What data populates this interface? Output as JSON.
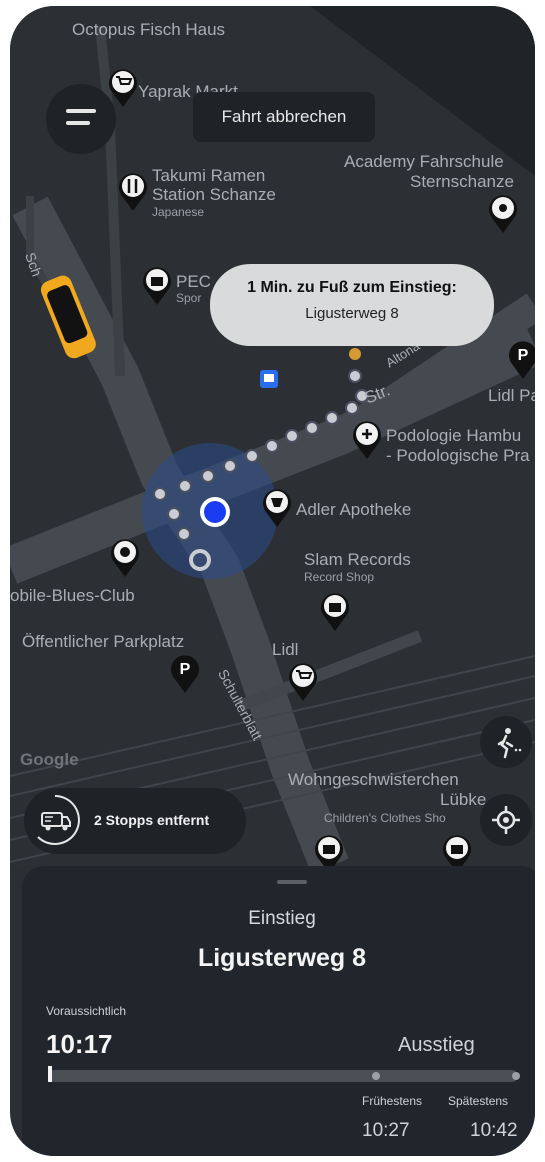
{
  "map": {
    "places": [
      {
        "id": "octopus",
        "name": "Octopus Fisch Haus"
      },
      {
        "id": "yaprak",
        "name": "Yaprak Markt"
      },
      {
        "id": "takumi1",
        "name": "Takumi Ramen"
      },
      {
        "id": "takumi2",
        "name": "Station Schanze"
      },
      {
        "id": "takumi3",
        "name": "Japanese"
      },
      {
        "id": "academy1",
        "name": "Academy Fahrschule"
      },
      {
        "id": "academy2",
        "name": "Sternschanze"
      },
      {
        "id": "pec1",
        "name": "PEC"
      },
      {
        "id": "pec2",
        "name": "Spor"
      },
      {
        "id": "lidl_pa",
        "name": "Lidl Pa"
      },
      {
        "id": "podo1",
        "name": "Podologie Hambu"
      },
      {
        "id": "podo2",
        "name": "- Podologische Pra"
      },
      {
        "id": "adler",
        "name": "Adler Apotheke"
      },
      {
        "id": "slam1",
        "name": "Slam Records"
      },
      {
        "id": "slam2",
        "name": "Record Shop"
      },
      {
        "id": "blues",
        "name": "obile-Blues-Club"
      },
      {
        "id": "parkplatz",
        "name": "Öffentlicher Parkplatz"
      },
      {
        "id": "lidl",
        "name": "Lidl"
      },
      {
        "id": "wohn1",
        "name": "Wohngeschwisterchen"
      },
      {
        "id": "wohn2",
        "name": "Lübke"
      },
      {
        "id": "wohn3",
        "name": "Children's Clothes Sho"
      }
    ],
    "streets": {
      "schulterblatt": "Schulterblatt",
      "altona_partial": "Altona",
      "str_partial": "Str.",
      "sch_partial": "Sch"
    },
    "google": "Google"
  },
  "ui": {
    "cancel_label": "Fahrt abbrechen",
    "walk_bubble": {
      "line1": "1 Min. zu Fuß zum Einstieg:",
      "line2": "Ligusterweg 8"
    },
    "stops_label": "2 Stopps entfernt"
  },
  "sheet": {
    "title": "Einstieg",
    "address": "Ligusterweg 8",
    "estimated_label": "Voraussichtlich",
    "estimated_time": "10:17",
    "dropoff_label": "Ausstieg",
    "earliest_label": "Frühestens",
    "latest_label": "Spätestens",
    "earliest_time": "10:27",
    "latest_time": "10:42"
  },
  "colors": {
    "map_bg": "#2c3035",
    "road": "#454a50",
    "user_dot": "#1a3df0",
    "accent_orange": "#d49a34",
    "taxi": "#f0a81e"
  },
  "icons": [
    "menu-icon",
    "walking-icon",
    "locate-icon",
    "van-stops-icon",
    "pin-cart-icon",
    "pin-cutlery-icon",
    "pin-bag-icon",
    "pin-parking-icon",
    "pin-medical-icon",
    "pin-pharmacy-icon",
    "pin-theater-icon",
    "bus-stop-icon",
    "taxi-icon"
  ]
}
